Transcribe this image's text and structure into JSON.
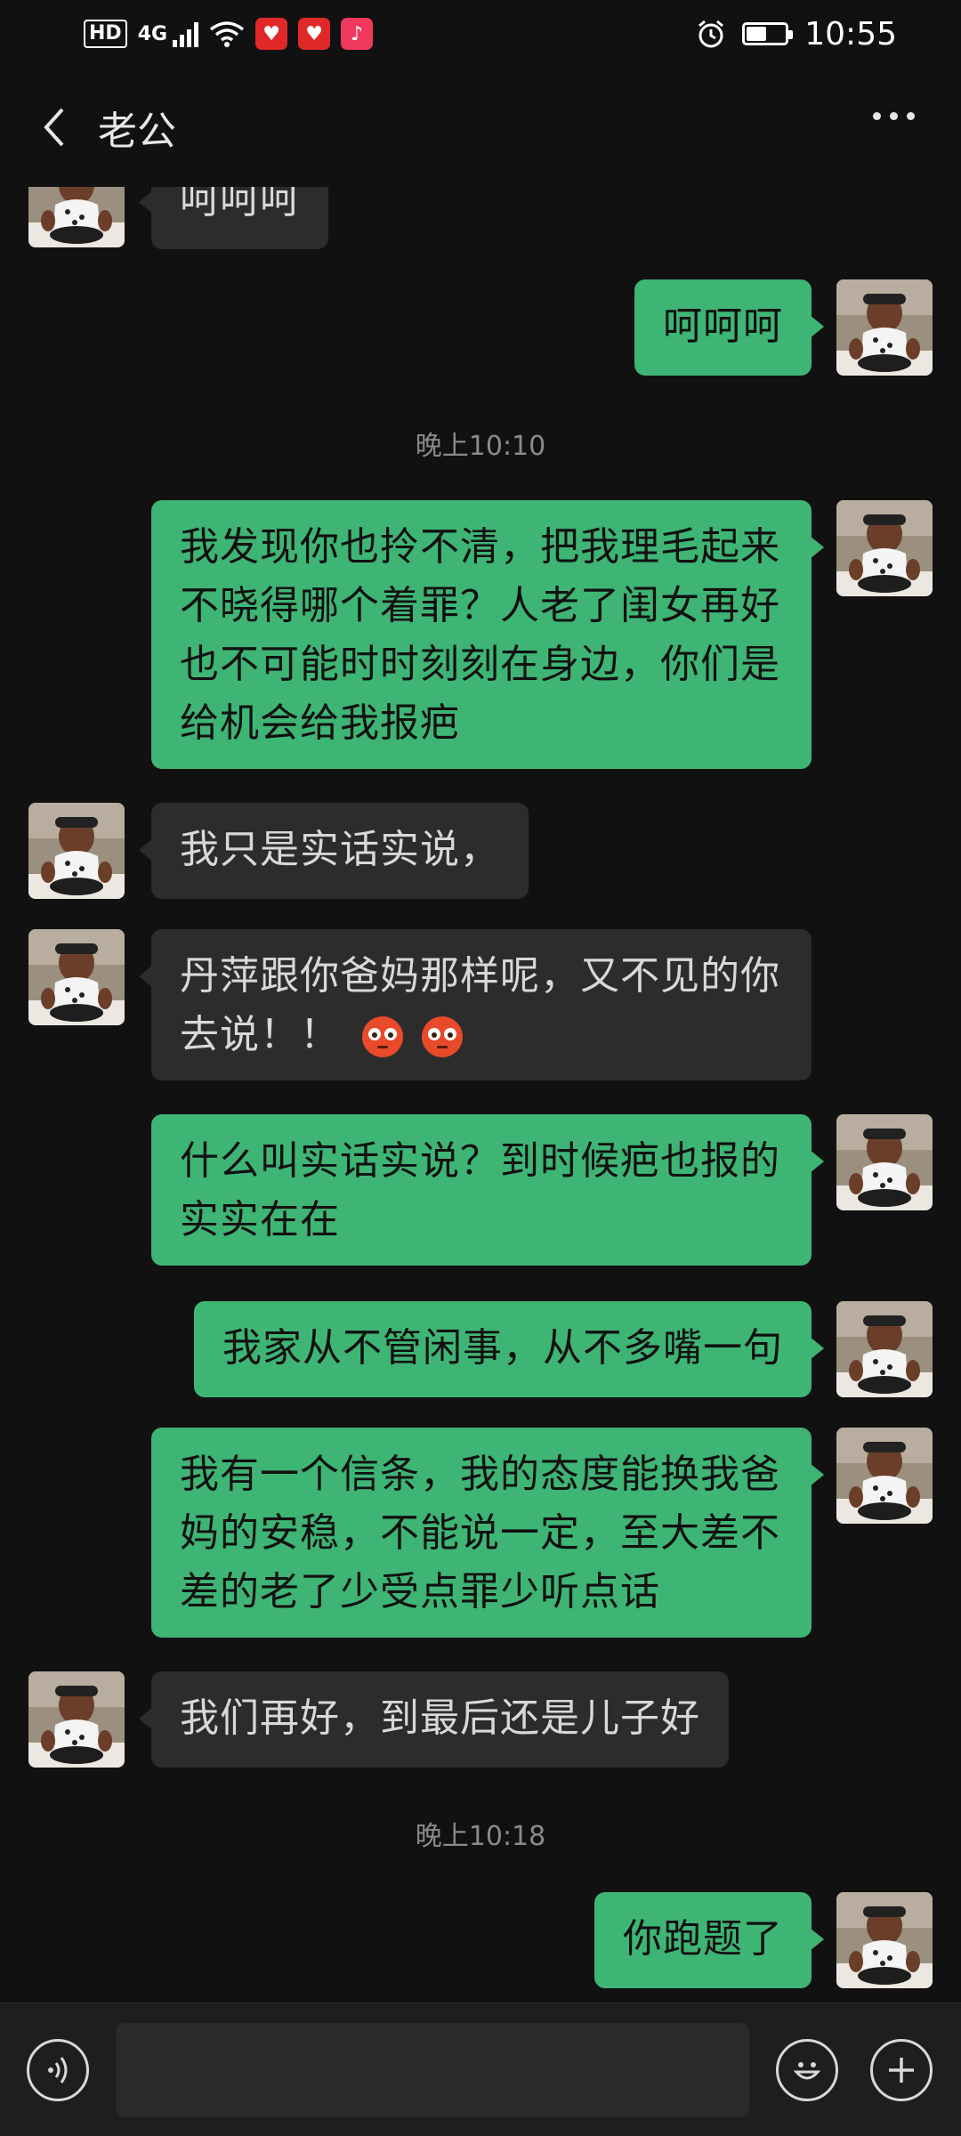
{
  "status_bar": {
    "hd_label": "HD",
    "network_label": "4G",
    "time": "10:55"
  },
  "header": {
    "title": "老公"
  },
  "messages": [
    {
      "sender": "other",
      "text": "呵呵呵"
    },
    {
      "sender": "me",
      "text": "呵呵呵"
    },
    {
      "type": "timestamp",
      "text": "晚上10:10"
    },
    {
      "sender": "me",
      "text": "我发现你也拎不清，把我理毛起来不晓得哪个着罪？人老了闺女再好也不可能时时刻刻在身边，你们是给机会给我报疤"
    },
    {
      "sender": "other",
      "text": "我只是实话实说，"
    },
    {
      "sender": "other",
      "text": "丹萍跟你爸妈那样呢，又不见的你去说！！",
      "emoji": [
        "flushed-face",
        "flushed-face"
      ]
    },
    {
      "sender": "me",
      "text": "什么叫实话实说？到时候疤也报的实实在在"
    },
    {
      "sender": "me",
      "text": "我家从不管闲事，从不多嘴一句"
    },
    {
      "sender": "me",
      "text": "我有一个信条，我的态度能换我爸妈的安稳，不能说一定，至大差不差的老了少受点罪少听点话"
    },
    {
      "sender": "other",
      "text": "我们再好，到最后还是儿子好"
    },
    {
      "type": "timestamp",
      "text": "晚上10:18"
    },
    {
      "sender": "me",
      "text": "你跑题了"
    }
  ],
  "input_bar": {
    "message_value": ""
  },
  "colors": {
    "background": "#111111",
    "my_bubble": "#3eb575",
    "other_bubble": "#2c2c2c",
    "timestamp_text": "#8a8a8a"
  }
}
